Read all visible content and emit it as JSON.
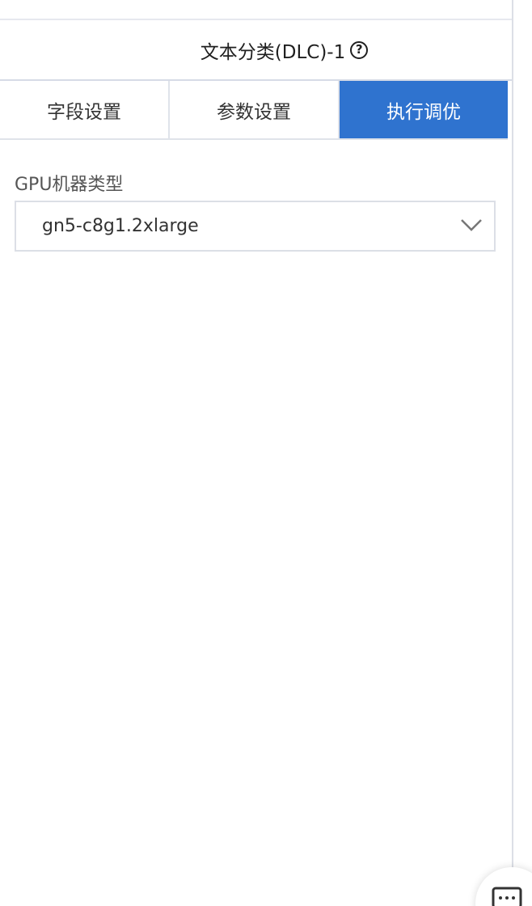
{
  "panel": {
    "title": "文本分类(DLC)-1",
    "help_icon": "question-circle-icon"
  },
  "tabs": [
    {
      "label": "字段设置",
      "active": false
    },
    {
      "label": "参数设置",
      "active": false
    },
    {
      "label": "执行调优",
      "active": true
    }
  ],
  "form": {
    "gpu_machine_type_label": "GPU机器类型",
    "gpu_machine_type_value": "gn5-c8g1.2xlarge",
    "dropdown_icon": "chevron-down-icon"
  },
  "floating": {
    "feedback_icon": "chat-bubble-icon"
  },
  "colors": {
    "active_tab": "#2f73cf",
    "border": "#dcdfe6"
  }
}
